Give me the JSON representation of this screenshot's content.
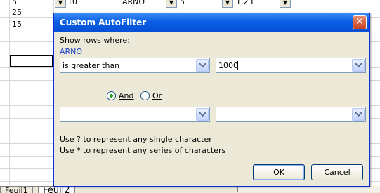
{
  "sheet": {
    "rows": [
      {
        "a": "5",
        "b": "10",
        "c": "ARNO",
        "d": "5",
        "e": "1,23"
      },
      {
        "a": "25",
        "b": "",
        "c": "",
        "d": "",
        "e": ""
      },
      {
        "a": "15",
        "b": "",
        "c": "",
        "d": "",
        "e": ""
      }
    ],
    "tabs": [
      "Feuil1",
      "Feuil2"
    ]
  },
  "dialog": {
    "title": "Custom AutoFilter",
    "show_rows_label": "Show rows where:",
    "field_name": "ARNO",
    "criteria1": {
      "operator": "is greater than",
      "value": "1000"
    },
    "criteria2": {
      "operator": "",
      "value": ""
    },
    "and_label": "And",
    "or_label": "Or",
    "logic_selected": "And",
    "hint1": "Use ? to represent any single character",
    "hint2": "Use * to represent any series of characters",
    "ok_label": "OK",
    "cancel_label": "Cancel"
  },
  "colors": {
    "titlebar": "#0a5fe4",
    "dialog_bg": "#ece9d8",
    "field_name": "#1a41c8",
    "radio_selected": "#21a121"
  }
}
